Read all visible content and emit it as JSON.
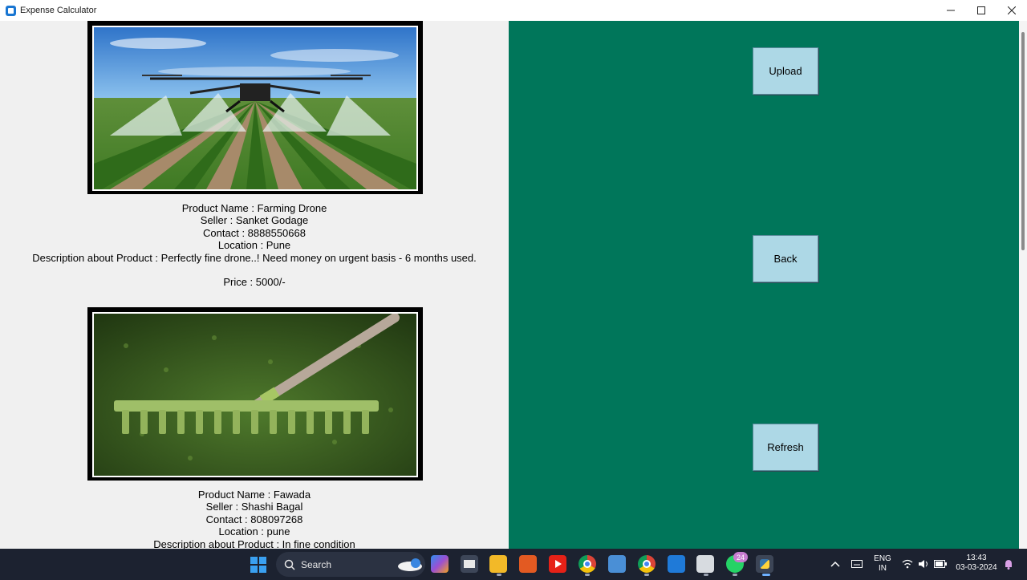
{
  "window": {
    "title": "Expense Calculator",
    "controls": [
      "minimize",
      "maximize",
      "close"
    ]
  },
  "products": [
    {
      "image_icon": "farming-drone-photo",
      "name_line": "Product Name : Farming Drone",
      "seller_line": "Seller : Sanket Godage",
      "contact_line": "Contact : 8888550668",
      "location_line": "Location : Pune",
      "description_line": "Description about Product : Perfectly fine drone..! Need money on urgent basis - 6 months used.",
      "price_line": "Price : 5000/-"
    },
    {
      "image_icon": "rake-fawada-photo",
      "name_line": "Product Name : Fawada",
      "seller_line": "Seller : Shashi Bagal",
      "contact_line": "Contact : 808097268",
      "location_line": "Location : pune",
      "description_line": "Description about Product : In fine condition"
    }
  ],
  "actions": {
    "upload_label": "Upload",
    "back_label": "Back",
    "refresh_label": "Refresh"
  },
  "colors": {
    "right_pane": "#00765a",
    "button_bg": "#add8e6",
    "left_pane": "#f0f0f0",
    "taskbar": "#1c2230"
  },
  "taskbar": {
    "search_label": "Search",
    "whatsapp_badge": "24",
    "language_line1": "ENG",
    "language_line2": "IN",
    "time": "13:43",
    "date": "03-03-2024"
  }
}
